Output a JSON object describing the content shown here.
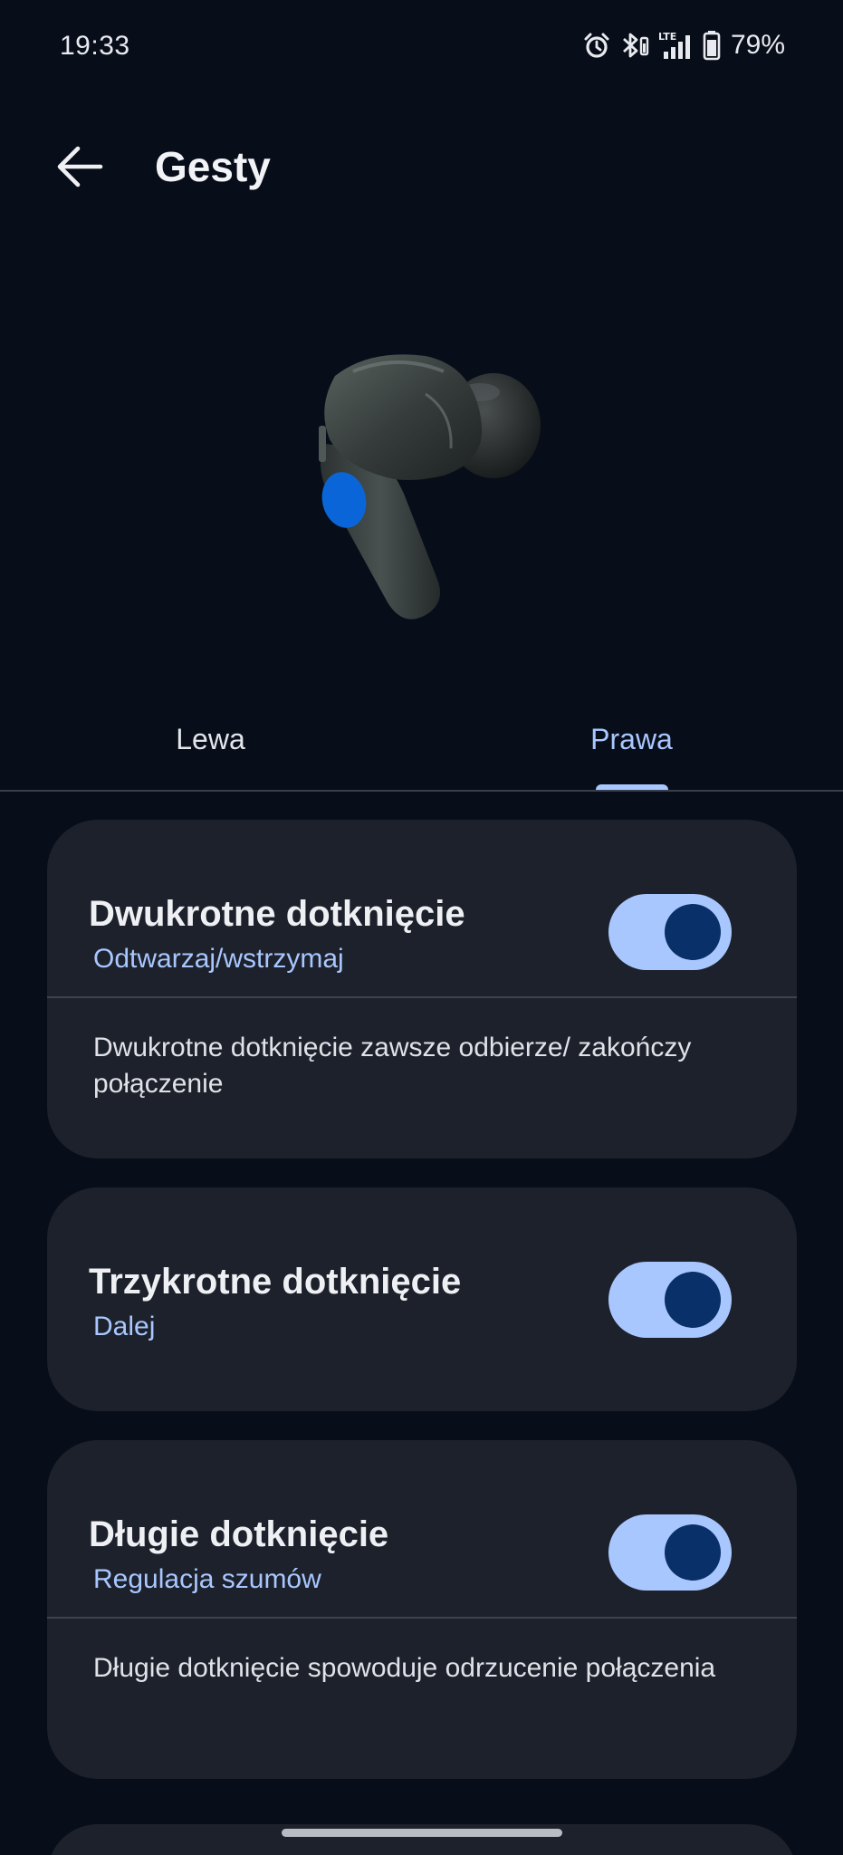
{
  "status_bar": {
    "time": "19:33",
    "battery_percent": "79%",
    "icons": [
      "alarm-icon",
      "bluetooth-icon",
      "lte-signal-icon",
      "battery-icon"
    ],
    "network_label": "LTE"
  },
  "header": {
    "title": "Gesty",
    "back_icon": "arrow-left-icon"
  },
  "illustration": {
    "name": "earbud-right",
    "highlight_color": "#0a66d8"
  },
  "tabs": [
    {
      "label": "Lewa",
      "selected": false
    },
    {
      "label": "Prawa",
      "selected": true
    }
  ],
  "gestures": [
    {
      "title": "Dwukrotne dotknięcie",
      "action": "Odtwarzaj/wstrzymaj",
      "enabled": true,
      "description": "Dwukrotne dotknięcie zawsze odbierze/ zakończy połączenie"
    },
    {
      "title": "Trzykrotne dotknięcie",
      "action": "Dalej",
      "enabled": true
    },
    {
      "title": "Długie dotknięcie",
      "action": "Regulacja szumów",
      "enabled": true,
      "description": "Długie dotknięcie spowoduje odrzucenie połączenia"
    }
  ],
  "colors": {
    "background": "#080e19",
    "card": "#1d212b",
    "accent": "#a9c7ff",
    "toggle_knob": "#0a3069"
  }
}
